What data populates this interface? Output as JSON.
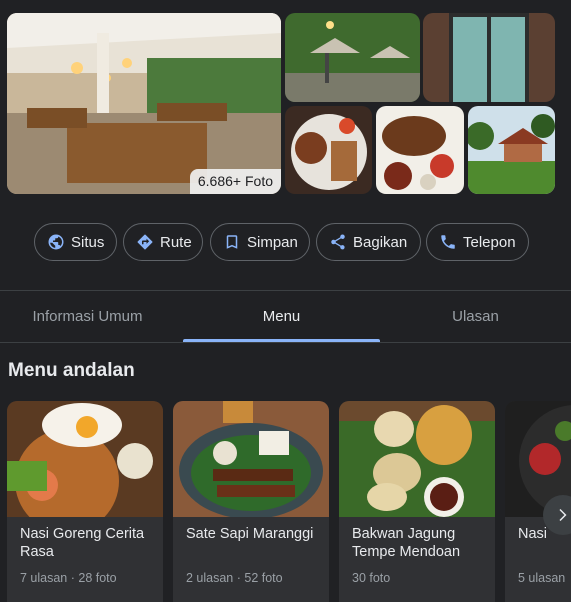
{
  "gallery": {
    "photo_count": "6.686+ Foto"
  },
  "actions": [
    {
      "label": "Situs",
      "icon": "globe-icon"
    },
    {
      "label": "Rute",
      "icon": "directions-icon"
    },
    {
      "label": "Simpan",
      "icon": "bookmark-icon"
    },
    {
      "label": "Bagikan",
      "icon": "share-icon"
    },
    {
      "label": "Telepon",
      "icon": "phone-icon"
    }
  ],
  "tabs": [
    {
      "label": "Informasi Umum",
      "active": false
    },
    {
      "label": "Menu",
      "active": true
    },
    {
      "label": "Ulasan",
      "active": false
    }
  ],
  "section": {
    "title": "Menu andalan"
  },
  "menu_items": [
    {
      "name": "Nasi Goreng Cerita Rasa",
      "reviews": "7 ulasan",
      "photos": "28 foto"
    },
    {
      "name": "Sate Sapi Maranggi",
      "reviews": "2 ulasan",
      "photos": "52 foto"
    },
    {
      "name": "Bakwan Jagung Tempe Mendoan",
      "reviews": "",
      "photos": "30 foto"
    },
    {
      "name": "Nasi",
      "reviews": "5 ulasan",
      "photos": ""
    }
  ],
  "colors": {
    "background": "#202124",
    "accent": "#8ab4f8",
    "card": "#303134"
  }
}
